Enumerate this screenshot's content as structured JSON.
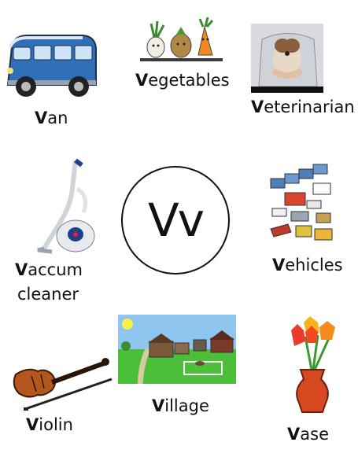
{
  "center": {
    "letters": "Vv"
  },
  "items": {
    "van": {
      "first": "V",
      "rest": "an"
    },
    "vegetables": {
      "first": "V",
      "rest": "egetables"
    },
    "veterinarian": {
      "first": "V",
      "rest": "eterinarian"
    },
    "vaccum_line1": {
      "first": "V",
      "rest": "accum"
    },
    "vaccum_line2": {
      "text": "cleaner"
    },
    "vehicles": {
      "first": "V",
      "rest": "ehicles"
    },
    "violin": {
      "first": "V",
      "rest": "iolin"
    },
    "village": {
      "first": "V",
      "rest": "illage"
    },
    "vase": {
      "first": "V",
      "rest": "ase"
    }
  },
  "icons": {
    "van": "van-icon",
    "vegetables": "vegetables-icon",
    "veterinarian": "veterinarian-icon",
    "vacuum": "vacuum-cleaner-icon",
    "vehicles": "vehicles-icon",
    "violin": "violin-icon",
    "village": "village-icon",
    "vase": "vase-icon"
  }
}
